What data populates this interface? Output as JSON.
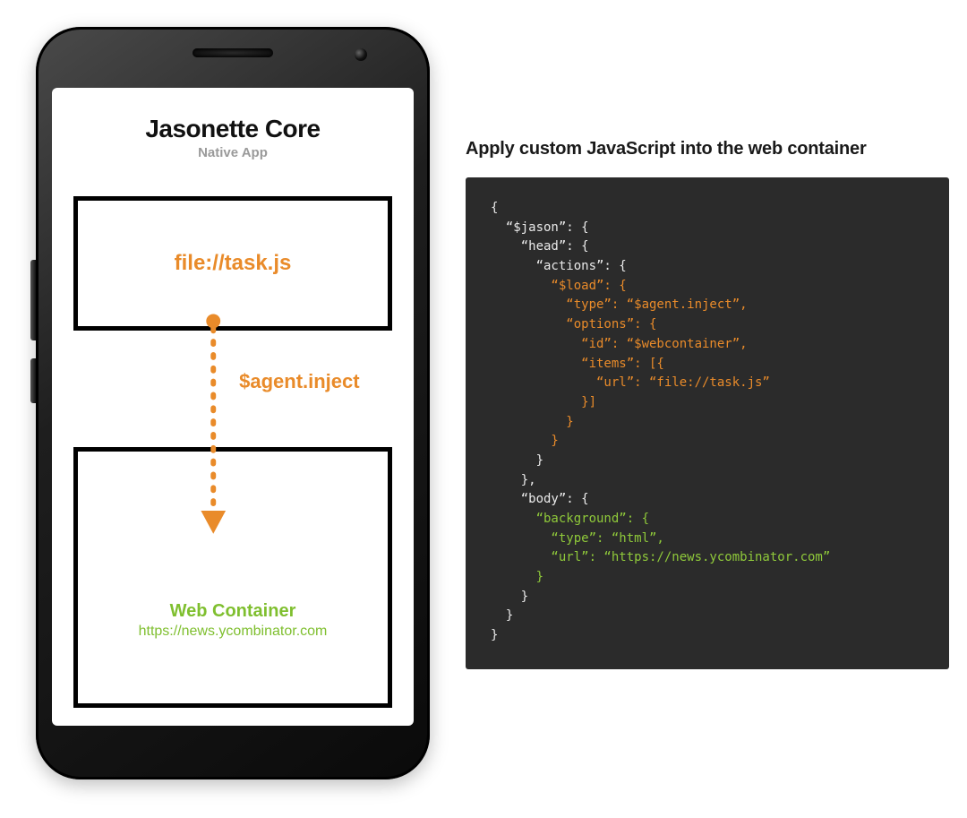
{
  "phone": {
    "title": "Jasonette Core",
    "subtitle": "Native App",
    "top_box_label": "file://task.js",
    "inject_label": "$agent.inject",
    "web_container_title": "Web Container",
    "web_container_url": "https://news.ycombinator.com"
  },
  "right": {
    "heading": "Apply custom JavaScript into the web container"
  },
  "code": {
    "l01": "{",
    "l02": "  “$jason”: {",
    "l03": "    “head”: {",
    "l04": "      “actions”: {",
    "l05": "        “$load”: {",
    "l06": "          “type”: “$agent.inject”,",
    "l07": "          “options”: {",
    "l08": "            “id”: “$webcontainer”,",
    "l09": "            “items”: [{",
    "l10": "              “url”: “file://task.js”",
    "l11": "            }]",
    "l12": "          }",
    "l13": "        }",
    "l14": "      }",
    "l15": "    },",
    "l16": "    “body”: {",
    "l17": "      “background”: {",
    "l18": "        “type”: “html”,",
    "l19": "        “url”: “https://news.ycombinator.com”",
    "l20": "      }",
    "l21": "    }",
    "l22": "  }",
    "l23": "}"
  },
  "colors": {
    "orange": "#e98b2a",
    "green": "#7fbf2f",
    "code_bg": "#2b2b2b"
  }
}
